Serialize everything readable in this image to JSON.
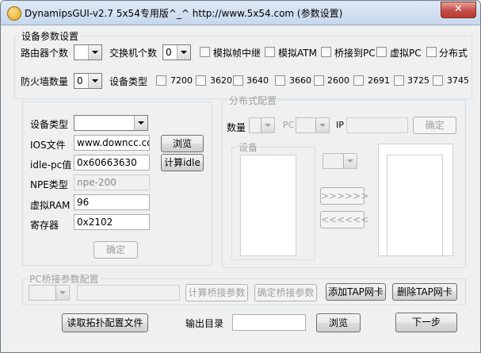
{
  "window": {
    "title": "DynamipsGUI-v2.7  5x54专用版^_^ http://www.5x54.com  (参数设置)",
    "close_symbol": "✕"
  },
  "device_group": {
    "legend": "设备参数设置",
    "router_count_label": "路由器个数",
    "router_count_value": "",
    "switch_count_label": "交换机个数",
    "switch_count_value": "0",
    "options": [
      "模拟帧中继",
      "模拟ATM",
      "桥接到PC",
      "虚拟PC",
      "分布式"
    ],
    "firewall_count_label": "防火墙数量",
    "firewall_count_value": "0",
    "device_type_label": "设备类型",
    "models": [
      "7200",
      "3620",
      "3640",
      "3660",
      "2600",
      "2691",
      "3725",
      "3745"
    ]
  },
  "left_panel": {
    "device_type_label": "设备类型",
    "device_type_value": "",
    "ios_label": "IOS文件",
    "ios_value": "www.downcc.com",
    "browse_label": "浏览",
    "idle_label": "idle-pc值",
    "idle_value": "0x60663630",
    "calc_idle_label": "计算idle",
    "npe_label": "NPE类型",
    "npe_value": "npe-200",
    "ram_label": "虚拟RAM",
    "ram_value": "96",
    "reg_label": "寄存器",
    "reg_value": "0x2102",
    "ok_label": "确定"
  },
  "distributed": {
    "legend": "分布式配置",
    "count_label": "数量",
    "pc_label": "PC",
    "ip_label": "IP",
    "ok_label": "确定",
    "device_legend": "设备",
    "move_right": ">>>>>>",
    "move_left": "<<<<<<"
  },
  "bridge": {
    "legend": "PC桥接参数配置",
    "calc_label": "计算桥接参数",
    "confirm_label": "确定桥接参数",
    "add_tap_label": "添加TAP网卡",
    "del_tap_label": "删除TAP网卡"
  },
  "bottom": {
    "read_topo_label": "读取拓扑配置文件",
    "output_dir_label": "输出目录",
    "output_dir_value": "",
    "browse_label": "浏览",
    "next_label": "下一步"
  }
}
